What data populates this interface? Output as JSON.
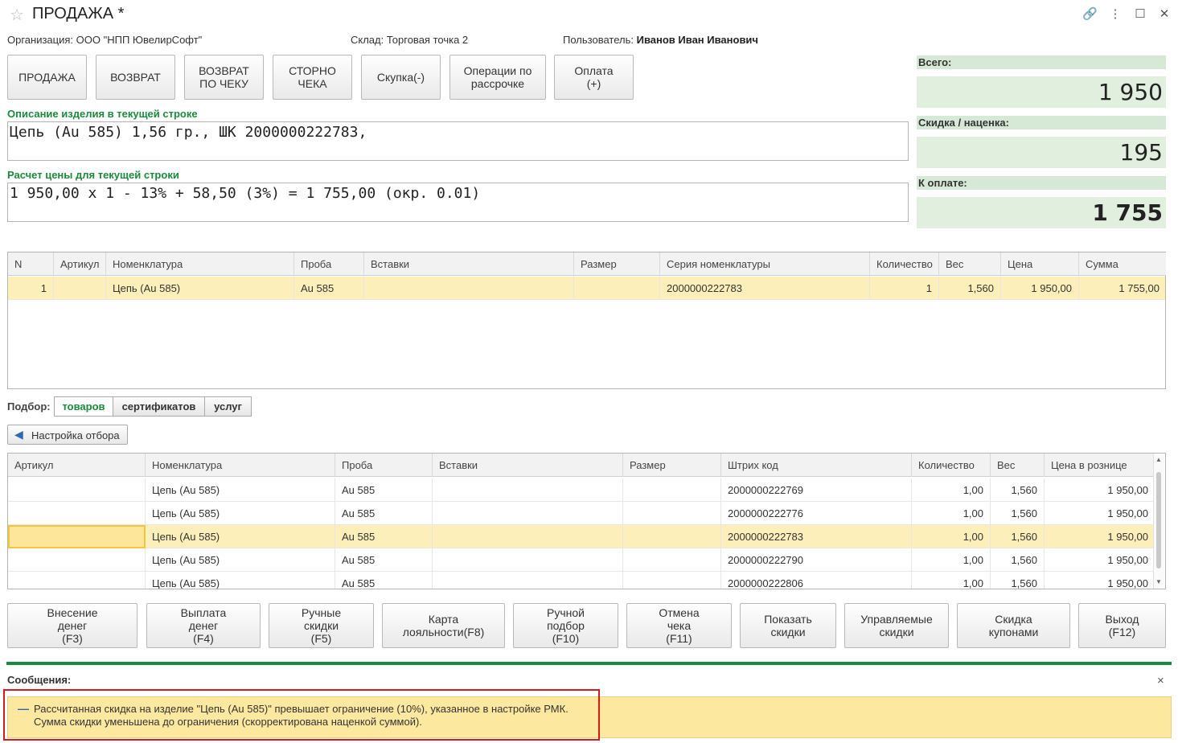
{
  "window": {
    "title": "ПРОДАЖА *"
  },
  "info": {
    "org_label": "Организация:",
    "org_value": "ООО \"НПП ЮвелирСофт\"",
    "store_label": "Склад:",
    "store_value": "Торговая точка 2",
    "user_label": "Пользователь:",
    "user_value": "Иванов Иван Иванович"
  },
  "ops": [
    "ПРОДАЖА",
    "ВОЗВРАТ",
    "ВОЗВРАТ\nПО ЧЕКУ",
    "СТОРНО\nЧЕКА",
    "Скупка(-)",
    "Операции по\nрассрочке",
    "Оплата\n(+)"
  ],
  "description": {
    "label": "Описание изделия в текущей строке",
    "value": "Цепь (Au 585) 1,56 гр., ШК 2000000222783,"
  },
  "price_calc": {
    "label": "Расчет цены для текущей строки",
    "value": "1 950,00 x 1 - 13% + 58,50 (3%) = 1 755,00 (окр. 0.01)"
  },
  "totals": {
    "total_label": "Всего:",
    "total_value": "1 950",
    "discount_label": "Скидка / наценка:",
    "discount_value": "195",
    "pay_label": "К оплате:",
    "pay_value": "1 755"
  },
  "cart": {
    "columns": [
      "N",
      "Артикул",
      "Номенклатура",
      "Проба",
      "Вставки",
      "Размер",
      "Серия номенклатуры",
      "Количество",
      "Вес",
      "Цена",
      "Сумма"
    ],
    "rows": [
      [
        "1",
        "",
        "Цепь (Au 585)",
        "Au 585",
        "",
        "",
        "2000000222783",
        "1",
        "1,560",
        "1 950,00",
        "1 755,00"
      ]
    ]
  },
  "selection": {
    "label": "Подбор:",
    "tabs": [
      "товаров",
      "сертификатов",
      "услуг"
    ],
    "filter_button": "Настройка отбора"
  },
  "stock": {
    "columns": [
      "Артикул",
      "Номенклатура",
      "Проба",
      "Вставки",
      "Размер",
      "Штрих код",
      "Количество",
      "Вес",
      "Цена в рознице"
    ],
    "rows": [
      [
        "",
        "Цепь (Au 585)",
        "Au 585",
        "",
        "",
        "2000000222769",
        "1,00",
        "1,560",
        "1 950,00"
      ],
      [
        "",
        "Цепь (Au 585)",
        "Au 585",
        "",
        "",
        "2000000222776",
        "1,00",
        "1,560",
        "1 950,00"
      ],
      [
        "",
        "Цепь (Au 585)",
        "Au 585",
        "",
        "",
        "2000000222783",
        "1,00",
        "1,560",
        "1 950,00"
      ],
      [
        "",
        "Цепь (Au 585)",
        "Au 585",
        "",
        "",
        "2000000222790",
        "1,00",
        "1,560",
        "1 950,00"
      ],
      [
        "",
        "Цепь (Au 585)",
        "Au 585",
        "",
        "",
        "2000000222806",
        "1,00",
        "1,560",
        "1 950,00"
      ]
    ]
  },
  "bottom_buttons": [
    "Внесение\nденег\n(F3)",
    "Выплата\nденег\n(F4)",
    "Ручные\nскидки\n(F5)",
    "Карта\nлояльности(F8)",
    "Ручной\nподбор\n(F10)",
    "Отмена\nчека\n(F11)",
    "Показать\nскидки",
    "Управляемые\nскидки",
    "Скидка\nкупонами",
    "Выход\n(F12)"
  ],
  "messages": {
    "title": "Сообщения:",
    "close": "×",
    "dash": "—",
    "text": "Рассчитанная скидка на изделие \"Цепь (Au 585)\" превышает ограничение (10%), указанное в настройке РМК.\nСумма скидки уменьшена до ограничения (скорректирована наценкой суммой)."
  },
  "colors": {
    "accent_green": "#1a8a3c",
    "total_bg": "#e1f0de",
    "selected_row": "#fcefb9",
    "message_bg": "#fde8a0",
    "highlight_red": "#d9191b"
  }
}
